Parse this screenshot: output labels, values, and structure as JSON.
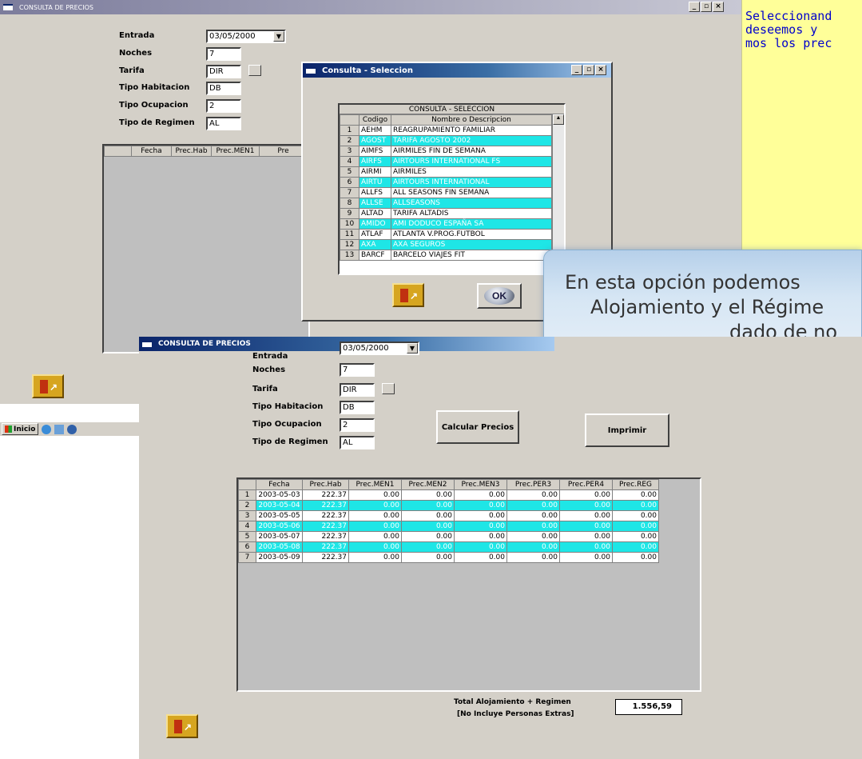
{
  "back_window": {
    "title": "CONSULTA DE PRECIOS",
    "labels": {
      "entrada": "Entrada",
      "noches": "Noches",
      "tarifa": "Tarifa",
      "tipo_habitacion": "Tipo Habitacion",
      "tipo_ocupacion": "Tipo Ocupacion",
      "tipo_regimen": "Tipo de Regimen"
    },
    "values": {
      "entrada": "03/05/2000",
      "noches": "7",
      "tarifa": "DIR",
      "tipo_habitacion": "DB",
      "tipo_ocupacion": "2",
      "tipo_regimen": "AL"
    },
    "grid_headers": [
      "",
      "Fecha",
      "Prec.Hab",
      "Prec.MEN1",
      "Pre"
    ]
  },
  "yellow_note": {
    "text": "Seleccionand\ndeseemos y\nmos los prec"
  },
  "dialog": {
    "title": "Consulta - Seleccion",
    "caption": "CONSULTA - SELECCION",
    "headers": [
      "",
      "Codigo",
      "Nombre o Descripcion"
    ],
    "rows": [
      {
        "n": "1",
        "code": "AEHM",
        "desc": "REAGRUPAMIENTO FAMILIAR",
        "hl": false
      },
      {
        "n": "2",
        "code": "AGOST",
        "desc": "TARIFA AGOSTO 2002",
        "hl": true
      },
      {
        "n": "3",
        "code": "AIMFS",
        "desc": "AIRMILES FIN DE SEMANA",
        "hl": false
      },
      {
        "n": "4",
        "code": "AIRFS",
        "desc": "AIRTOURS INTERNATIONAL FS",
        "hl": true
      },
      {
        "n": "5",
        "code": "AIRMI",
        "desc": "AIRMILES",
        "hl": false
      },
      {
        "n": "6",
        "code": "AIRTU",
        "desc": "AIRTOURS INTERNATIONAL",
        "hl": true
      },
      {
        "n": "7",
        "code": "ALLFS",
        "desc": "ALL SEASONS FIN SEMANA",
        "hl": false
      },
      {
        "n": "8",
        "code": "ALLSE",
        "desc": "ALLSEASONS",
        "hl": true
      },
      {
        "n": "9",
        "code": "ALTAD",
        "desc": "TARIFA ALTADIS",
        "hl": false
      },
      {
        "n": "10",
        "code": "AMIDO",
        "desc": "AMI DODUCO ESPAÑA SA",
        "hl": true
      },
      {
        "n": "11",
        "code": "ATLAF",
        "desc": "ATLANTA V.PROG.FUTBOL",
        "hl": false
      },
      {
        "n": "12",
        "code": "AXA",
        "desc": "AXA SEGUROS",
        "hl": true
      },
      {
        "n": "13",
        "code": "BARCF",
        "desc": "BARCELO VIAJES FIT",
        "hl": false
      }
    ],
    "ok_label": "OK"
  },
  "callout": {
    "line1": "En esta opción podemos",
    "line2": "Alojamiento y el Régime",
    "line3": "dado de no"
  },
  "taskbar": {
    "start_label": "Inicio"
  },
  "front_window": {
    "title": "CONSULTA DE PRECIOS",
    "labels": {
      "entrada": "Entrada",
      "noches": "Noches",
      "tarifa": "Tarifa",
      "tipo_habitacion": "Tipo Habitacion",
      "tipo_ocupacion": "Tipo Ocupacion",
      "tipo_regimen": "Tipo de Regimen"
    },
    "values": {
      "entrada": "03/05/2000",
      "noches": "7",
      "tarifa": "DIR",
      "tipo_habitacion": "DB",
      "tipo_ocupacion": "2",
      "tipo_regimen": "AL"
    },
    "calc_button": "Calcular Precios",
    "print_button": "Imprimir",
    "grid_headers": [
      "",
      "Fecha",
      "Prec.Hab",
      "Prec.MEN1",
      "Prec.MEN2",
      "Prec.MEN3",
      "Prec.PER3",
      "Prec.PER4",
      "Prec.REG"
    ],
    "rows": [
      {
        "n": "1",
        "fecha": "2003-05-03",
        "hab": "222.37",
        "men1": "0.00",
        "men2": "0.00",
        "men3": "0.00",
        "per3": "0.00",
        "per4": "0.00",
        "reg": "0.00",
        "hl": false
      },
      {
        "n": "2",
        "fecha": "2003-05-04",
        "hab": "222.37",
        "men1": "0.00",
        "men2": "0.00",
        "men3": "0.00",
        "per3": "0.00",
        "per4": "0.00",
        "reg": "0.00",
        "hl": true
      },
      {
        "n": "3",
        "fecha": "2003-05-05",
        "hab": "222.37",
        "men1": "0.00",
        "men2": "0.00",
        "men3": "0.00",
        "per3": "0.00",
        "per4": "0.00",
        "reg": "0.00",
        "hl": false
      },
      {
        "n": "4",
        "fecha": "2003-05-06",
        "hab": "222.37",
        "men1": "0.00",
        "men2": "0.00",
        "men3": "0.00",
        "per3": "0.00",
        "per4": "0.00",
        "reg": "0.00",
        "hl": true
      },
      {
        "n": "5",
        "fecha": "2003-05-07",
        "hab": "222.37",
        "men1": "0.00",
        "men2": "0.00",
        "men3": "0.00",
        "per3": "0.00",
        "per4": "0.00",
        "reg": "0.00",
        "hl": false
      },
      {
        "n": "6",
        "fecha": "2003-05-08",
        "hab": "222.37",
        "men1": "0.00",
        "men2": "0.00",
        "men3": "0.00",
        "per3": "0.00",
        "per4": "0.00",
        "reg": "0.00",
        "hl": true
      },
      {
        "n": "7",
        "fecha": "2003-05-09",
        "hab": "222.37",
        "men1": "0.00",
        "men2": "0.00",
        "men3": "0.00",
        "per3": "0.00",
        "per4": "0.00",
        "reg": "0.00",
        "hl": false
      }
    ],
    "total_label": "Total Alojamiento + Regimen",
    "total_note": "[No Incluye Personas Extras]",
    "total_value": "1.556,59"
  }
}
